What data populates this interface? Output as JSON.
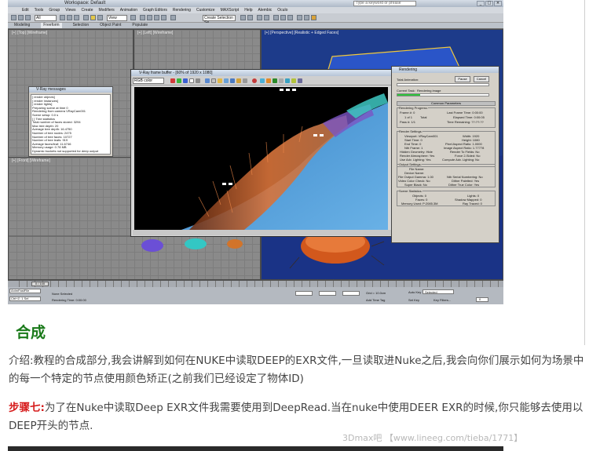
{
  "app": {
    "window_title": "Workspace: Default",
    "search_placeholder": "Type a keyword or phrase",
    "window_buttons": [
      "_",
      "□",
      "×"
    ],
    "menus": [
      "Edit",
      "Tools",
      "Group",
      "Views",
      "Create",
      "Modifiers",
      "Animation",
      "Graph Editors",
      "Rendering",
      "Customize",
      "MAXScript",
      "Help",
      "Alembic",
      "Oculo"
    ],
    "toolbar_selects": [
      "All",
      "View",
      "Create Selection Se"
    ],
    "ribbon_tabs": [
      "Modeling",
      "Freeform",
      "Selection",
      "Object Paint",
      "Populate"
    ],
    "ribbon_active_index": 1,
    "viewports": {
      "top_left": "[+] [Top] [Wireframe]",
      "top_right": "[+] [Left] [Wireframe]",
      "perspective": "[+] [Perspective] [Realistic + Edged Faces]",
      "front": "[+] [Front] [Wireframe]"
    },
    "frame_buffer": {
      "title": "V-Ray frame buffer - [60% of 1920 x 1080]",
      "channel": "RGB color"
    },
    "messages": {
      "title": "V-Ray messages",
      "lines": [
        "[ render objects]",
        "[ render instances]",
        "[ render lights]",
        "Preparing scene at time 0",
        "Rendering from camera VRayCam001",
        "Scene setup: 0.0 s",
        "[ ] Tree statistics",
        "Total number of faces stored: 3294",
        "Max tree depth: 20",
        "Average tree depth: 16.4750",
        "Number of tree nodes: 2475",
        "Number of tree faces: 10727",
        "Number of tree leafs: 919",
        "Average faces/leaf: 11.6746",
        "Memory usage: 0.78 MB",
        "Dynamic buckets not supported for deep output"
      ]
    },
    "progress": {
      "title": "Rendering",
      "total_animation": "Total Animation:",
      "current_task_label": "Current Task:",
      "current_task_value": "Rendering image",
      "buttons": [
        "Pause",
        "Cancel"
      ],
      "total_fraction": 0.0,
      "task_fraction": 0.25,
      "section_title": "Common Parameters",
      "rendering_progress": {
        "title": "Rendering Progress:",
        "frame": "Frame #: 0",
        "of": "1 of 1",
        "total_label": "Total",
        "pass": "Pass #: 1/1",
        "last_frame_time": "Last Frame Time: 0:00:00",
        "elapsed_time": "Elapsed Time: 0:00:05",
        "time_remaining": "Time Remaining: ??:??:??"
      },
      "render_settings": [
        "Viewport: VRayCam001",
        "Start Time: 0",
        "End Time: 0",
        "Nth Frame: 1",
        "Hidden Geometry: Hide",
        "Render Atmosphere: Yes",
        "Use Adv. Lighting: Yes",
        "Width: 1920",
        "Height: 1080",
        "Pixel Aspect Ratio: 1.0000",
        "Image Aspect Ratio: 1.77778",
        "Render To Fields: No",
        "Force 2-Sided: No",
        "Compute Adv. Lighting: No"
      ],
      "output_settings": [
        "File Name:",
        "Device Name:",
        "File Output Gamma: 1.00",
        "Video Color Check: No",
        "Super Black: No",
        "Nth Serial Numbering: No",
        "Dither Paletted: Yes",
        "Dither True Color: Yes"
      ],
      "scene_stats": [
        "Objects: 0",
        "Faces: 0",
        "Memory Used: P:2085.3M",
        "Lights: 0",
        "Shadow Mapped: 0",
        "Ray Traced: 0"
      ]
    },
    "timeline": {
      "frame_label": "0 / 100"
    },
    "status": {
      "maxscript": "AnimFastFile",
      "undo": "Ctrl+Z: 1 Sel",
      "selection": "None Selected",
      "rendering_time": "Rendering Time: 0:00:00",
      "grid": "Grid = 10.0cm",
      "add_time_tag": "Add Time Tag",
      "auto_key": "Auto Key",
      "auto_key_value": "Selected",
      "set_key": "Set Key",
      "key_filters": "Key Filters...",
      "frame_value": "0"
    }
  },
  "article": {
    "heading": "合成",
    "intro": "介绍:教程的合成部分,我会讲解到如何在NUKE中读取DEEP的EXR文件,一旦读取进Nuke之后,我会向你们展示如何为场景中的每一个特定的节点使用颜色矫正(之前我们已经设定了物体ID)",
    "step_label": "步骤七:",
    "step_text": "为了在Nuke中读取Deep EXR文件我需要使用到DeepRead.当在nuke中使用DEER EXR的时候,你只能够去使用以DEEP开头的节点.",
    "watermark": "3Dmax吧 【www.lineeg.com/tieba/1771】"
  },
  "colors": {
    "heading_green": "#1a7a1a",
    "step_red": "#d61a1a",
    "body_text": "#444444",
    "viewport_blue": "#1d3b8a",
    "progress_green": "#2fc43b"
  }
}
